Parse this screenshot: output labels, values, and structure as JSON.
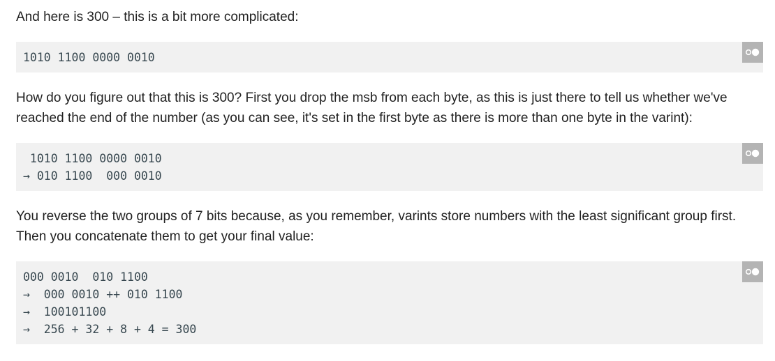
{
  "paragraphs": {
    "p1": "And here is 300 – this is a bit more complicated:",
    "p2": "How do you figure out that this is 300? First you drop the msb from each byte, as this is just there to tell us whether we've reached the end of the number (as you can see, it's set in the first byte as there is more than one byte in the varint):",
    "p3": "You reverse the two groups of 7 bits because, as you remember, varints store numbers with the least significant group first. Then you concatenate them to get your final value:"
  },
  "code_blocks": [
    {
      "lines": [
        "1010 1100 0000 0010"
      ]
    },
    {
      "lines": [
        " 1010 1100 0000 0010",
        "→ 010 1100  000 0010"
      ]
    },
    {
      "lines": [
        "000 0010  010 1100",
        "→  000 0010 ++ 010 1100",
        "→  100101100",
        "→  256 + 32 + 8 + 4 = 300"
      ]
    }
  ],
  "copy_button": {
    "icon": "toggle-icon",
    "color": "#b4b4b4"
  }
}
